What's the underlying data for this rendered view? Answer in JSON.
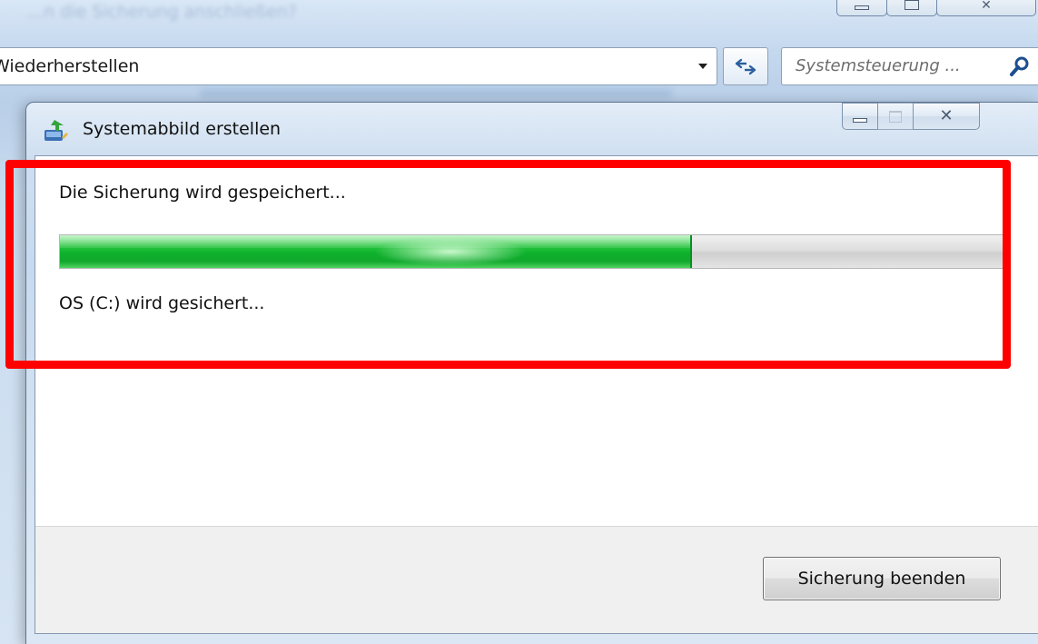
{
  "background_window": {
    "title_blurred": "...n die Sicherung anschließen?",
    "address_bar": {
      "path": "Wiederherstellen",
      "dropdown_icon": "chevron-down-icon",
      "refresh_icon": "refresh-arrows-icon"
    },
    "search": {
      "placeholder": "Systemsteuerung ...",
      "icon": "magnifier-icon"
    }
  },
  "dialog": {
    "title": "Systemabbild erstellen",
    "title_icon": "backup-app-icon",
    "caption_buttons": {
      "minimize_icon": "minimize-icon",
      "maximize_icon": "maximize-icon",
      "close_label": "✕"
    },
    "status": "Die Sicherung wird gespeichert...",
    "progress": {
      "percent": 67
    },
    "substatus": "OS (C:) wird gesichert...",
    "footer": {
      "stop_button_label": "Sicherung beenden"
    }
  },
  "annotation": {
    "highlight_color": "#ff0000"
  },
  "colors": {
    "progress_green": "#0db12b",
    "chrome_blue": "#c8daee"
  }
}
